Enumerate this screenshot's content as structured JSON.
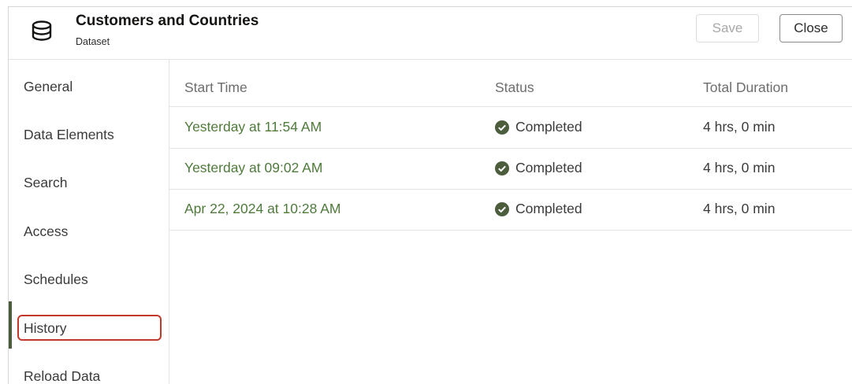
{
  "header": {
    "title": "Customers and Countries",
    "subtitle": "Dataset",
    "icon": "database-icon",
    "save_label": "Save",
    "close_label": "Close"
  },
  "sidebar": {
    "items": [
      {
        "label": "General"
      },
      {
        "label": "Data Elements"
      },
      {
        "label": "Search"
      },
      {
        "label": "Access"
      },
      {
        "label": "Schedules"
      },
      {
        "label": "History",
        "active": true
      },
      {
        "label": "Reload Data"
      }
    ]
  },
  "table": {
    "columns": [
      "Start Time",
      "Status",
      "Total Duration"
    ],
    "rows": [
      {
        "start": "Yesterday at 11:54 AM",
        "status": "Completed",
        "duration": "4 hrs, 0 min"
      },
      {
        "start": "Yesterday at 09:02 AM",
        "status": "Completed",
        "duration": "4 hrs, 0 min"
      },
      {
        "start": "Apr 22, 2024 at 10:28 AM",
        "status": "Completed",
        "duration": "4 hrs, 0 min"
      }
    ]
  },
  "colors": {
    "link_green": "#4e7a3a",
    "status_icon": "#4c5d3d",
    "active_bar": "#4c5d3d",
    "highlight_border": "#c0392b"
  }
}
